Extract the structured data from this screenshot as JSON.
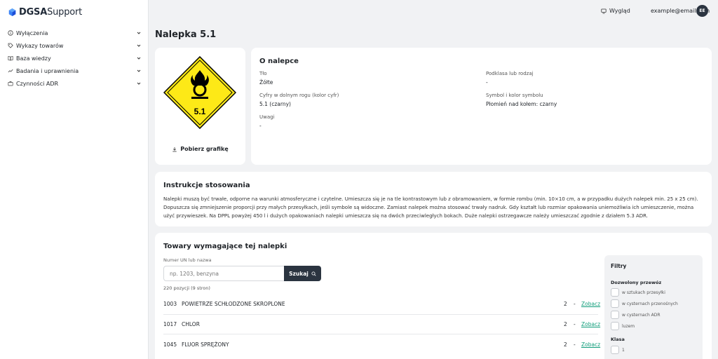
{
  "app": {
    "logo_bold": "DGSA",
    "logo_light": "Support"
  },
  "sidebar": {
    "items": [
      {
        "label": "Wyłączenia",
        "icon": "info-circle-icon"
      },
      {
        "label": "Wykazy towarów",
        "icon": "tag-icon"
      },
      {
        "label": "Baza wiedzy",
        "icon": "book-icon"
      },
      {
        "label": "Badania i uprawnienia",
        "icon": "trend-icon"
      },
      {
        "label": "Czynności ADR",
        "icon": "briefcase-icon"
      }
    ]
  },
  "topbar": {
    "appearance": "Wygląd",
    "email": "example@email.com",
    "avatar": "EE"
  },
  "page": {
    "title": "Nalepka 5.1"
  },
  "placard": {
    "number": "5.1",
    "bg_color": "#fde917",
    "symbol_color": "#000000",
    "download_label": "Pobierz grafikę"
  },
  "about": {
    "title": "O nalepce",
    "fields": [
      {
        "key": "Tło",
        "value": "Żółte"
      },
      {
        "key": "Podklasa lub rodzaj",
        "value": "-"
      },
      {
        "key": "Cyfry w dolnym rogu (kolor cyfr)",
        "value": "5.1 (czarny)"
      },
      {
        "key": "Symbol i kolor symbolu",
        "value": "Płomień nad kołem: czarny"
      },
      {
        "key": "Uwagi",
        "value": "-"
      }
    ]
  },
  "instructions": {
    "title": "Instrukcje stosowania",
    "text": "Nalepki muszą być trwałe, odporne na warunki atmosferyczne i czytelne. Umieszcza się je na tle kontrastowym lub z obramowaniem, w formie rombu (min. 10×10 cm, a w przypadku dużych nalepek min. 25 x 25 cm). Dopuszcza się zmniejszenie proporcji przy małych przesyłkach, jeśli symbole są widoczne. Zamiast nalepek można stosować trwały nadruk. Gdy kształt lub rozmiar opakowania uniemożliwia ich umieszczenie, można użyć przywieszek. Na DPPL powyżej 450 l i dużych opakowaniach nalepki umieszcza się na dwóch przeciwległych bokach. Duże nalepki ostrzegawcze należy umieszczać zgodnie z działem 5.3 ADR."
  },
  "goods": {
    "title": "Towary wymagające tej nalepki",
    "search_label": "Numer UN lub nazwa",
    "search_placeholder": "np. 1203, benzyna",
    "search_button": "Szukaj",
    "count": "220 pozycji (9 stron)",
    "rows": [
      {
        "un": "1003",
        "name": "POWIETRZE SCHŁODZONE SKROPLONE",
        "class": "2",
        "dash": "-",
        "link": "Zobacz"
      },
      {
        "un": "1017",
        "name": "CHLOR",
        "class": "2",
        "dash": "-",
        "link": "Zobacz"
      },
      {
        "un": "1045",
        "name": "FLUOR SPRĘŻONY",
        "class": "2",
        "dash": "-",
        "link": "Zobacz"
      }
    ]
  },
  "filters": {
    "title": "Filtry",
    "transport_title": "Dozwolony przewóz",
    "transport_options": [
      "w sztukach przesyłki",
      "w cysternach przenośnych",
      "w cysternach ADR",
      "luzem"
    ],
    "class_title": "Klasa",
    "class_options": [
      "1"
    ]
  },
  "colors": {
    "accent": "#0f9d7a",
    "dark": "#2b3440"
  }
}
